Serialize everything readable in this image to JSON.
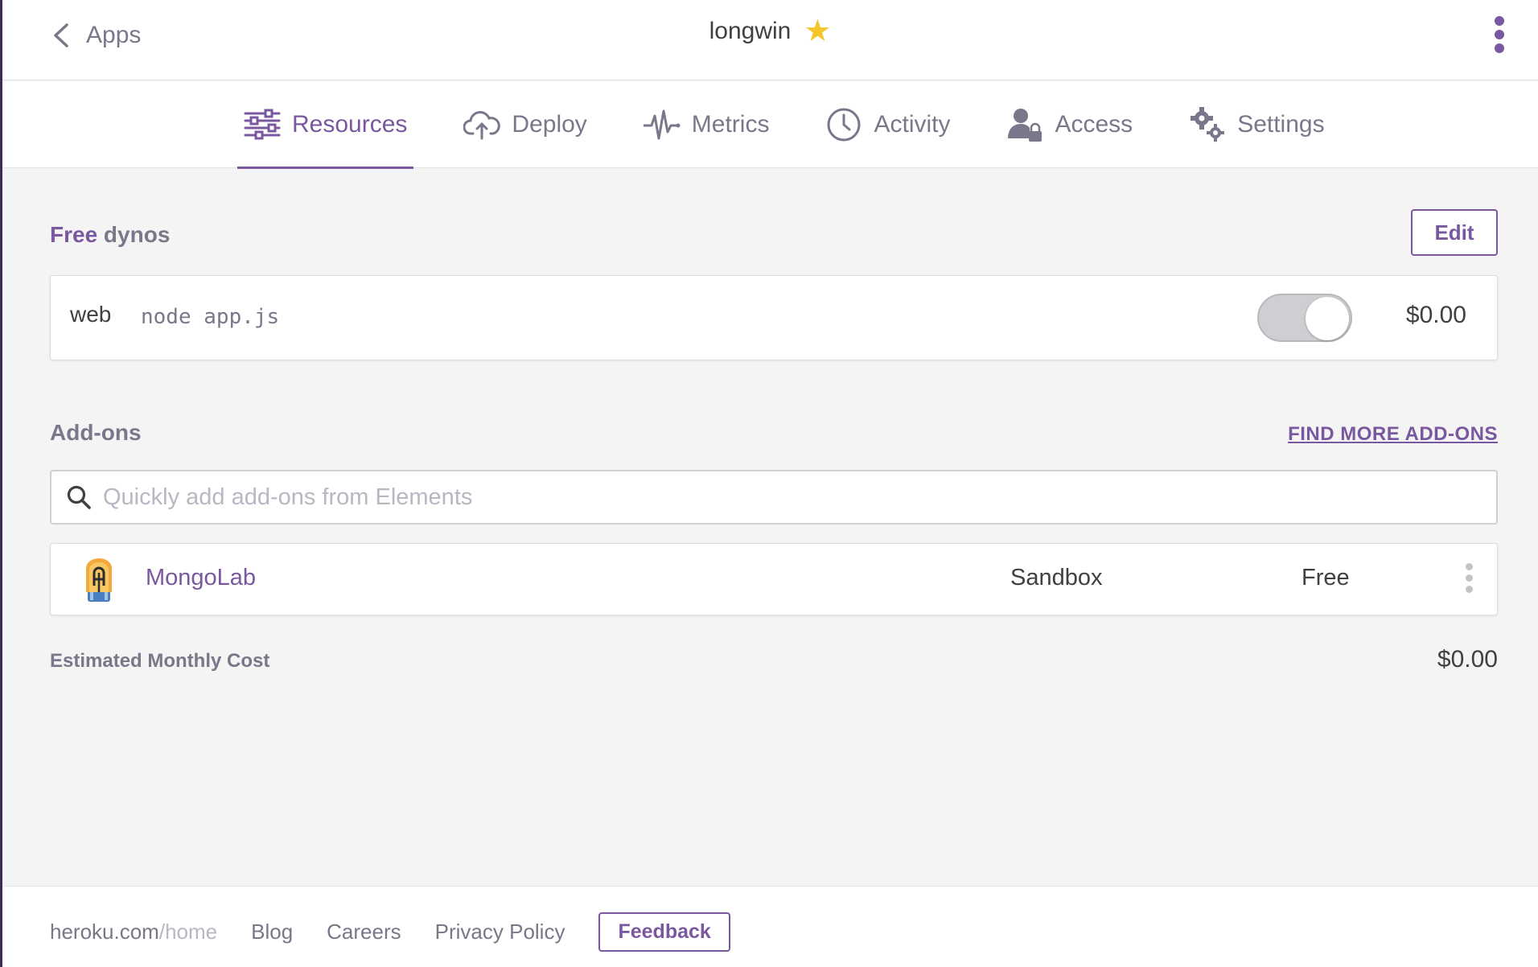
{
  "header": {
    "back_label": "Apps",
    "app_name": "longwin",
    "favorite_icon": "star-icon",
    "menu_icon": "kebab-menu-icon"
  },
  "tabs": [
    {
      "label": "Resources",
      "icon": "resources-icon",
      "active": true
    },
    {
      "label": "Deploy",
      "icon": "cloud-upload-icon",
      "active": false
    },
    {
      "label": "Metrics",
      "icon": "pulse-icon",
      "active": false
    },
    {
      "label": "Activity",
      "icon": "clock-icon",
      "active": false
    },
    {
      "label": "Access",
      "icon": "user-lock-icon",
      "active": false
    },
    {
      "label": "Settings",
      "icon": "gears-icon",
      "active": false
    }
  ],
  "dynos": {
    "title_accent": "Free",
    "title_rest": " dynos",
    "edit_label": "Edit",
    "items": [
      {
        "type": "web",
        "command": "node app.js",
        "enabled": true,
        "cost": "$0.00"
      }
    ]
  },
  "addons": {
    "title": "Add-ons",
    "find_more_label": "FIND MORE ADD-ONS",
    "search_placeholder": "Quickly add add-ons from Elements",
    "items": [
      {
        "name": "MongoLab",
        "plan": "Sandbox",
        "price": "Free",
        "icon": "mongolab-logo-icon"
      }
    ]
  },
  "estimate": {
    "label": "Estimated Monthly Cost",
    "value": "$0.00"
  },
  "footer": {
    "domain": "heroku.com",
    "domain_suffix": "/home",
    "links": [
      "Blog",
      "Careers",
      "Privacy Policy"
    ],
    "feedback_label": "Feedback"
  },
  "colors": {
    "accent": "#79589f",
    "star": "#f4c62a",
    "text": "#3f3f44",
    "muted": "#79778a"
  }
}
